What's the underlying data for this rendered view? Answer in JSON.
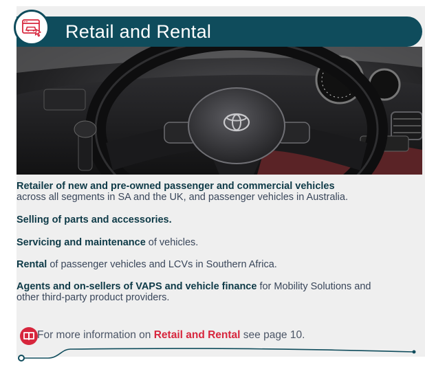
{
  "section": {
    "title": "Retail and Rental",
    "icon": "car-showroom-icon"
  },
  "photo": {
    "subject": "steering-wheel-photo"
  },
  "items": [
    {
      "bold": "Retailer of new and pre-owned passenger and commercial vehicles",
      "rest": "across all segments in SA and the UK, and passenger vehicles in Australia."
    },
    {
      "bold": "Selling of parts and accessories.",
      "rest": ""
    },
    {
      "bold": "Servicing and maintenance",
      "rest": " of vehicles."
    },
    {
      "bold": "Rental",
      "rest": " of passenger vehicles and LCVs in Southern Africa."
    },
    {
      "bold": "Agents and on-sellers of VAPS and vehicle finance",
      "rest": " for Mobility Solutions and other third-party product providers."
    }
  ],
  "more_info": {
    "prefix": "For more information on ",
    "highlight": "Retail and Rental",
    "suffix": " see page 10.",
    "icon": "book-icon"
  },
  "colors": {
    "banner": "#0f4c5c",
    "accent": "#d7263d",
    "card_bg": "#efefef"
  }
}
